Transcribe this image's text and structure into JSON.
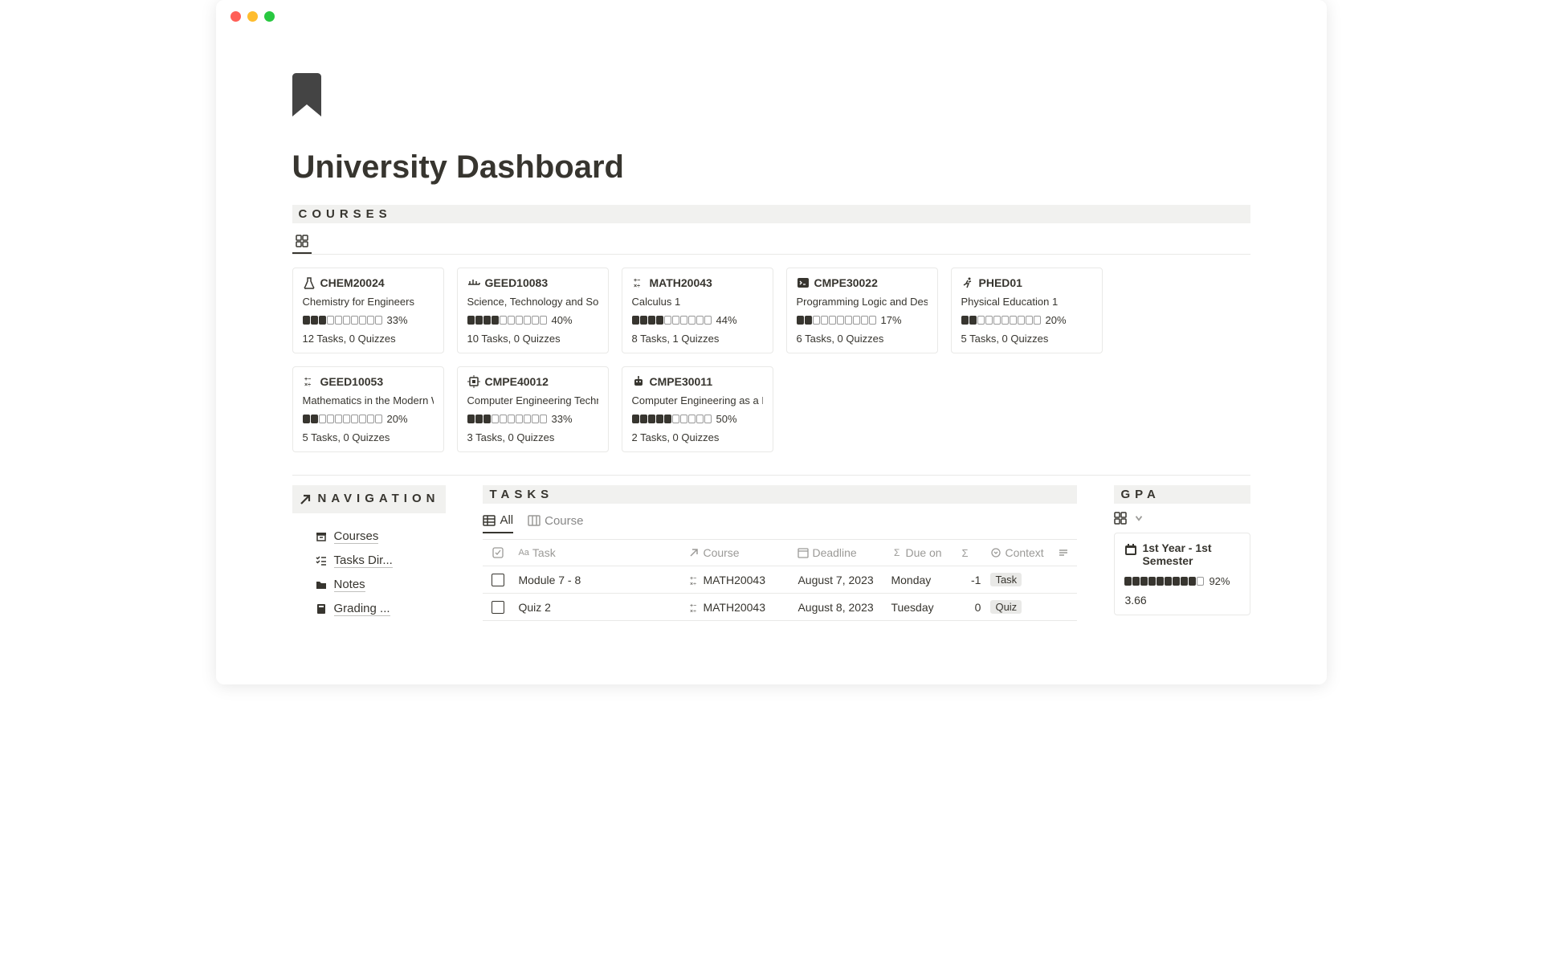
{
  "page_title": "University Dashboard",
  "sections": {
    "courses_label": "COURSES",
    "tasks_label": "TASKS",
    "gpa_label": "GPA",
    "nav_label": "NAVIGATION"
  },
  "courses": [
    {
      "code": "CHEM20024",
      "name": "Chemistry for Engineers",
      "filled": 3,
      "total": 10,
      "percent": "33%",
      "tasks": "12 Tasks, 0 Quizzes",
      "icon": "flask"
    },
    {
      "code": "GEED10083",
      "name": "Science, Technology and Society",
      "filled": 4,
      "total": 10,
      "percent": "40%",
      "tasks": "10 Tasks, 0 Quizzes",
      "icon": "bridge"
    },
    {
      "code": "MATH20043",
      "name": "Calculus 1",
      "filled": 4,
      "total": 10,
      "percent": "44%",
      "tasks": "8 Tasks, 1 Quizzes",
      "icon": "math"
    },
    {
      "code": "CMPE30022",
      "name": "Programming Logic and Design",
      "filled": 2,
      "total": 10,
      "percent": "17%",
      "tasks": "6 Tasks, 0 Quizzes",
      "icon": "terminal"
    },
    {
      "code": "PHED01",
      "name": "Physical Education 1",
      "filled": 2,
      "total": 10,
      "percent": "20%",
      "tasks": "5 Tasks, 0 Quizzes",
      "icon": "run"
    },
    {
      "code": "GEED10053",
      "name": "Mathematics in the Modern World",
      "filled": 2,
      "total": 10,
      "percent": "20%",
      "tasks": "5 Tasks, 0 Quizzes",
      "icon": "math"
    },
    {
      "code": "CMPE40012",
      "name": "Computer Engineering Technology",
      "filled": 3,
      "total": 10,
      "percent": "33%",
      "tasks": "3 Tasks, 0 Quizzes",
      "icon": "chip"
    },
    {
      "code": "CMPE30011",
      "name": "Computer Engineering as a Discipline",
      "filled": 5,
      "total": 10,
      "percent": "50%",
      "tasks": "2 Tasks, 0 Quizzes",
      "icon": "robot"
    }
  ],
  "nav_items": [
    {
      "icon": "archive",
      "label": "Courses"
    },
    {
      "icon": "checklist",
      "label": "Tasks Dir..."
    },
    {
      "icon": "folder",
      "label": "Notes"
    },
    {
      "icon": "book",
      "label": "Grading ..."
    }
  ],
  "tasks_view_tabs": {
    "all": "All",
    "course": "Course"
  },
  "tasks_columns": {
    "task": "Task",
    "course": "Course",
    "deadline": "Deadline",
    "dueon": "Due on",
    "context": "Context"
  },
  "tasks": [
    {
      "name": "Module 7 - 8",
      "course": "MATH20043",
      "deadline": "August 7, 2023",
      "dueon": "Monday",
      "sigma": "-1",
      "context": "Task"
    },
    {
      "name": "Quiz 2",
      "course": "MATH20043",
      "deadline": "August 8, 2023",
      "dueon": "Tuesday",
      "sigma": "0",
      "context": "Quiz"
    }
  ],
  "gpa_card": {
    "title": "1st Year - 1st Semester",
    "filled": 9,
    "total": 10,
    "percent": "92%",
    "value": "3.66"
  }
}
